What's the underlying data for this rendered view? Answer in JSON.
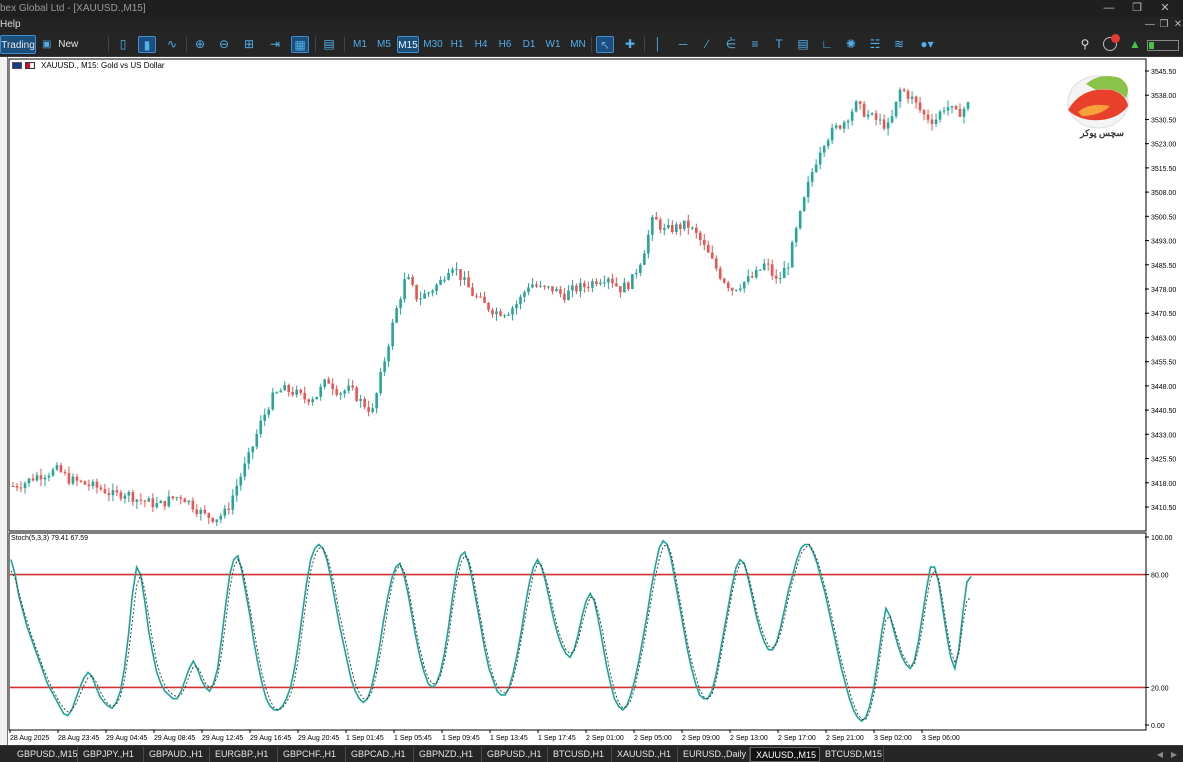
{
  "titlebar": {
    "title": "bex Global Ltd - [XAUUSD.,M15]"
  },
  "menubar": {
    "help_label": "Help"
  },
  "toolbar": {
    "trading_label": "Trading",
    "new_order_label": "New Order",
    "timeframes": [
      "M1",
      "M5",
      "M15",
      "M30",
      "H1",
      "H4",
      "H6",
      "D1",
      "W1",
      "MN"
    ],
    "active_timeframe": "M15"
  },
  "chart": {
    "symbol_header": "XAUUSD., M15:  Gold vs US Dollar",
    "logo_text": "سچس پوکر",
    "stoch_label": "Stoch(5,3,3) 79.41 67.59"
  },
  "chart_data": [
    {
      "type": "candlestick",
      "title": "XAUUSD., M15:  Gold vs US Dollar",
      "y_ticks": [
        "3545.50",
        "3538.00",
        "3530.50",
        "3523.00",
        "3515.50",
        "3508.00",
        "3500.50",
        "3493.00",
        "3485.50",
        "3478.00",
        "3470.50",
        "3463.00",
        "3455.50",
        "3448.00",
        "3440.50",
        "3433.00",
        "3425.50",
        "3418.00",
        "3410.50"
      ],
      "ylim": [
        3405.5,
        3547.5
      ],
      "x_ticks": [
        "28 Aug 2025",
        "28 Aug 23:45",
        "29 Aug 04:45",
        "29 Aug 08:45",
        "29 Aug 12:45",
        "29 Aug 16:45",
        "29 Aug 20:45",
        "1 Sep 01:45",
        "1 Sep 05:45",
        "1 Sep 09:45",
        "1 Sep 13:45",
        "1 Sep 17:45",
        "2 Sep 01:00",
        "2 Sep 05:00",
        "2 Sep 09:00",
        "2 Sep 13:00",
        "2 Sep 17:00",
        "2 Sep 21:00",
        "3 Sep 02:00",
        "3 Sep 06:00"
      ],
      "close_path": [
        3417,
        3418,
        3420,
        3421,
        3422,
        3419,
        3418,
        3417,
        3416,
        3414,
        3415,
        3413,
        3412,
        3411,
        3413,
        3414,
        3411,
        3408,
        3407,
        3409,
        3418,
        3426,
        3436,
        3444,
        3447,
        3446,
        3444,
        3445,
        3450,
        3446,
        3447,
        3443,
        3440,
        3455,
        3470,
        3482,
        3475,
        3477,
        3480,
        3486,
        3481,
        3476,
        3473,
        3471,
        3471,
        3474,
        3480,
        3478,
        3478,
        3476,
        3478,
        3479,
        3481,
        3482,
        3478,
        3480,
        3488,
        3500,
        3496,
        3497,
        3498,
        3494,
        3488,
        3482,
        3478,
        3480,
        3482,
        3486,
        3480,
        3486,
        3500,
        3513,
        3523,
        3527,
        3530,
        3535,
        3532,
        3530,
        3528,
        3540,
        3537,
        3532,
        3530,
        3535,
        3532,
        3535
      ],
      "candle_count": 240,
      "up_color": "#26a69a",
      "down_color": "#ef5350"
    },
    {
      "type": "line",
      "title": "Stoch(5,3,3) 79.41 67.59",
      "y_ticks": [
        "100.00",
        "80.00",
        "20.00",
        "0.00"
      ],
      "ylim": [
        0,
        100
      ],
      "levels": [
        80,
        20
      ],
      "series": [
        {
          "values": [
            88,
            80,
            68,
            60,
            52,
            46,
            40,
            34,
            28,
            22,
            18,
            14,
            10,
            6,
            5,
            8,
            14,
            20,
            25,
            28,
            26,
            20,
            15,
            12,
            10,
            9,
            12,
            18,
            30,
            48,
            70,
            84,
            80,
            66,
            50,
            38,
            28,
            22,
            18,
            16,
            14,
            14,
            18,
            24,
            30,
            34,
            30,
            24,
            20,
            18,
            22,
            30,
            46,
            64,
            80,
            88,
            90,
            82,
            70,
            58,
            44,
            32,
            22,
            14,
            10,
            8,
            8,
            10,
            14,
            20,
            30,
            44,
            60,
            76,
            88,
            94,
            96,
            94,
            88,
            78,
            66,
            54,
            44,
            34,
            24,
            18,
            14,
            12,
            14,
            20,
            30,
            42,
            56,
            68,
            78,
            84,
            86,
            80,
            70,
            58,
            46,
            36,
            28,
            22,
            20,
            22,
            28,
            38,
            52,
            68,
            82,
            90,
            92,
            86,
            76,
            64,
            52,
            40,
            30,
            24,
            18,
            16,
            16,
            20,
            28,
            38,
            50,
            64,
            76,
            84,
            88,
            84,
            76,
            66,
            56,
            48,
            42,
            38,
            36,
            40,
            48,
            58,
            66,
            70,
            66,
            56,
            44,
            32,
            22,
            14,
            10,
            8,
            10,
            16,
            24,
            34,
            46,
            58,
            72,
            84,
            94,
            98,
            96,
            88,
            76,
            64,
            52,
            40,
            30,
            22,
            16,
            14,
            14,
            18,
            26,
            38,
            50,
            62,
            74,
            84,
            88,
            86,
            78,
            68,
            58,
            50,
            44,
            40,
            40,
            44,
            52,
            62,
            72,
            80,
            88,
            94,
            96,
            96,
            92,
            86,
            78,
            70,
            60,
            50,
            40,
            30,
            22,
            14,
            8,
            4,
            2,
            4,
            10,
            20,
            34,
            50,
            62,
            58,
            50,
            42,
            36,
            32,
            30,
            34,
            44,
            58,
            72,
            84,
            84,
            76,
            62,
            48,
            36,
            30,
            40,
            60,
            76,
            79
          ],
          "color": "#1aa59a"
        },
        {
          "values": [
            82,
            78,
            70,
            62,
            55,
            48,
            42,
            36,
            30,
            25,
            20,
            16,
            12,
            9,
            7,
            8,
            11,
            16,
            21,
            25,
            26,
            23,
            18,
            14,
            11,
            10,
            11,
            15,
            24,
            38,
            56,
            74,
            80,
            72,
            58,
            44,
            33,
            26,
            21,
            18,
            16,
            15,
            16,
            20,
            26,
            31,
            31,
            27,
            22,
            20,
            21,
            26,
            38,
            55,
            72,
            84,
            88,
            84,
            74,
            62,
            50,
            38,
            27,
            19,
            13,
            9,
            8,
            9,
            12,
            16,
            24,
            36,
            52,
            68,
            82,
            90,
            94,
            94,
            90,
            82,
            72,
            60,
            50,
            40,
            30,
            22,
            17,
            14,
            14,
            17,
            25,
            36,
            48,
            62,
            74,
            82,
            85,
            82,
            74,
            62,
            50,
            40,
            31,
            25,
            22,
            22,
            26,
            34,
            46,
            62,
            76,
            86,
            90,
            88,
            80,
            68,
            56,
            44,
            34,
            26,
            21,
            18,
            17,
            19,
            25,
            34,
            46,
            58,
            70,
            80,
            86,
            85,
            78,
            70,
            60,
            51,
            45,
            40,
            38,
            39,
            45,
            54,
            62,
            68,
            67,
            60,
            50,
            38,
            27,
            18,
            12,
            9,
            10,
            13,
            20,
            30,
            41,
            53,
            66,
            78,
            88,
            95,
            96,
            91,
            80,
            68,
            56,
            44,
            34,
            26,
            19,
            15,
            14,
            16,
            23,
            34,
            46,
            58,
            70,
            80,
            86,
            86,
            80,
            71,
            61,
            53,
            47,
            42,
            41,
            43,
            49,
            58,
            68,
            77,
            84,
            91,
            94,
            96,
            93,
            88,
            81,
            73,
            64,
            54,
            44,
            34,
            26,
            18,
            11,
            6,
            3,
            3,
            7,
            16,
            28,
            44,
            56,
            58,
            52,
            45,
            38,
            34,
            31,
            32,
            40,
            52,
            66,
            78,
            82,
            78,
            66,
            52,
            40,
            33,
            38,
            54,
            66,
            68
          ],
          "color": "#333333",
          "dashed": true
        }
      ]
    }
  ],
  "tabs": [
    "GBPUSD.,M15",
    "GBPJPY.,H1",
    "GBPAUD.,H1",
    "EURGBP.,H1",
    "GBPCHF.,H1",
    "GBPCAD.,H1",
    "GBPNZD.,H1",
    "GBPUSD.,H1",
    "BTCUSD,H1",
    "XAUUSD.,H1",
    "EURUSD.,Daily",
    "XAUUSD.,M15",
    "BTCUSD,M15"
  ],
  "active_tab": "XAUUSD.,M15"
}
